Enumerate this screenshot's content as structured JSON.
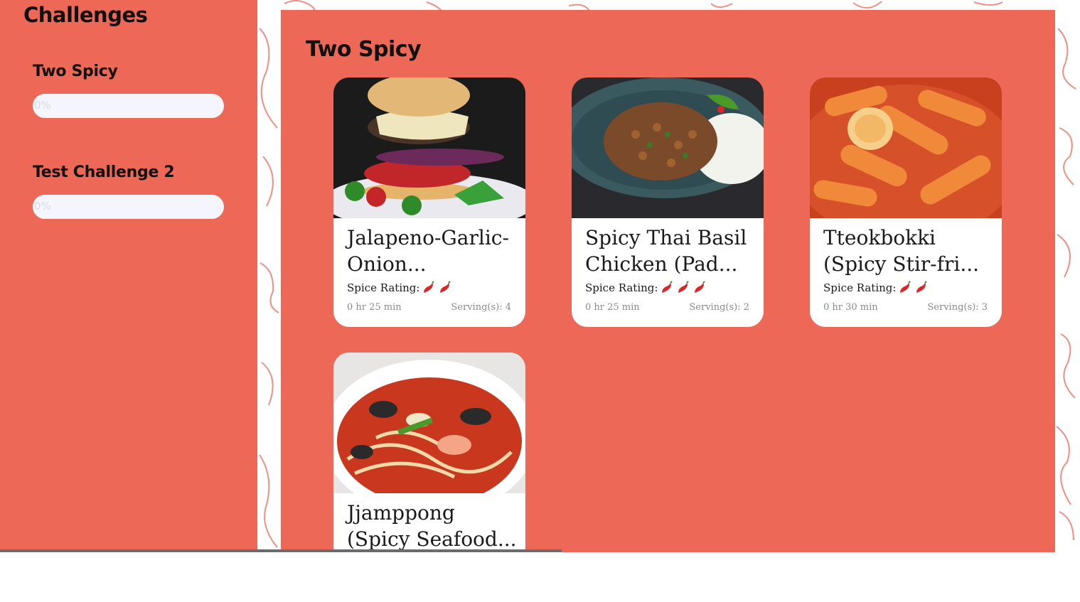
{
  "sidebar": {
    "title": "Challenges",
    "challenges": [
      {
        "name": "Two Spicy",
        "progress_label": "0%",
        "progress": 0
      },
      {
        "name": "Test Challenge 2",
        "progress_label": "0%",
        "progress": 0
      }
    ]
  },
  "main": {
    "title": "Two Spicy",
    "spice_label": "Spice Rating:",
    "recipes": [
      {
        "title": "Jalapeno-Garlic-Onion...",
        "spice": 2,
        "time": "0 hr 25 min",
        "servings": "Serving(s): 4",
        "photo": "burger"
      },
      {
        "title": "Spicy Thai Basil Chicken (Pad...",
        "spice": 3,
        "time": "0 hr 25 min",
        "servings": "Serving(s): 2",
        "photo": "basil-chicken"
      },
      {
        "title": "Tteokbokki (Spicy Stir-fri...",
        "spice": 2,
        "time": "0 hr 30 min",
        "servings": "Serving(s): 3",
        "photo": "tteokbokki"
      },
      {
        "title": "Jjamppong (Spicy Seafood...",
        "spice": 0,
        "time": "",
        "servings": "",
        "photo": "jjamppong"
      }
    ]
  },
  "colors": {
    "accent": "#ee6858",
    "track": "#f5f6fd"
  }
}
